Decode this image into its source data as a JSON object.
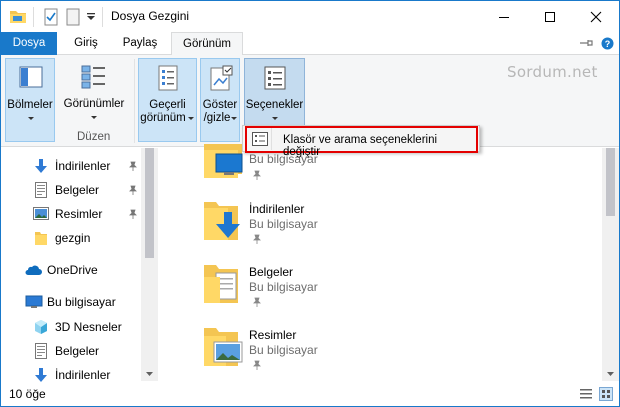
{
  "window": {
    "title": "Dosya Gezgini",
    "accent_color": "#1979ca",
    "highlight_color": "#e40000"
  },
  "quick_access_toolbar": {
    "icons": [
      "folder-icon",
      "properties-icon",
      "new-folder-icon",
      "customize-caret-icon"
    ]
  },
  "tabs": [
    {
      "label": "Dosya"
    },
    {
      "label": "Giriş"
    },
    {
      "label": "Paylaş"
    },
    {
      "label": "Görünüm"
    }
  ],
  "ribbon": {
    "buttons": {
      "panes": "Bölmeler",
      "layout": "Görünümler",
      "current_view_line1": "Geçerli",
      "current_view_line2": "görünüm",
      "show_hide_line1": "Göster",
      "show_hide_line2": "/gizle",
      "options": "Seçenekler"
    },
    "group_label": "Düzen",
    "watermark": "Sordum.net"
  },
  "options_menu": {
    "item": "Klasör ve arama seçeneklerini değiştir"
  },
  "nav_pane": {
    "items": [
      {
        "label": "İndirilenler",
        "icon": "download-arrow-icon",
        "pinned": true
      },
      {
        "label": "Belgeler",
        "icon": "documents-icon",
        "pinned": true
      },
      {
        "label": "Resimler",
        "icon": "pictures-icon",
        "pinned": true
      },
      {
        "label": "gezgin",
        "icon": "folder-icon",
        "pinned": false
      },
      {
        "label": "OneDrive",
        "icon": "onedrive-cloud-icon",
        "pinned": false
      },
      {
        "label": "Bu bilgisayar",
        "icon": "this-pc-icon",
        "pinned": false
      },
      {
        "label": "3D Nesneler",
        "icon": "3d-objects-icon",
        "pinned": false
      },
      {
        "label": "Belgeler",
        "icon": "documents-icon",
        "pinned": false
      },
      {
        "label": "İndirilenler",
        "icon": "download-arrow-icon",
        "pinned": false
      }
    ]
  },
  "content": {
    "tiles": [
      {
        "name": "",
        "location": "Bu bilgisayar",
        "icon": "desktop-folder-icon"
      },
      {
        "name": "İndirilenler",
        "location": "Bu bilgisayar",
        "icon": "downloads-folder-icon"
      },
      {
        "name": "Belgeler",
        "location": "Bu bilgisayar",
        "icon": "documents-folder-icon"
      },
      {
        "name": "Resimler",
        "location": "Bu bilgisayar",
        "icon": "pictures-folder-icon"
      }
    ]
  },
  "status_bar": {
    "item_count": "10 öğe"
  }
}
